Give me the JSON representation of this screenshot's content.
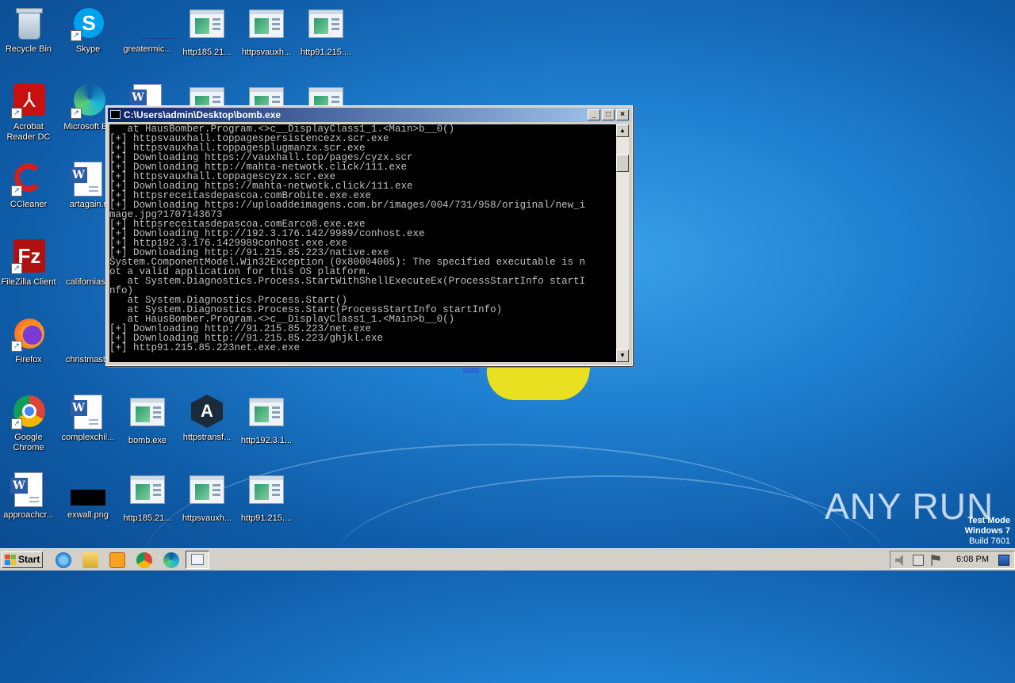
{
  "desktop": {
    "icons": [
      {
        "label": "Recycle Bin"
      },
      {
        "label": "Skype"
      },
      {
        "label": "greatermic..."
      },
      {
        "label": "http185.21..."
      },
      {
        "label": "httpsvauxh..."
      },
      {
        "label": "http91.215...."
      },
      {
        "label": "Acrobat Reader DC"
      },
      {
        "label": "Microsoft Ed"
      },
      {
        "label": "CCleaner"
      },
      {
        "label": "artagain.r"
      },
      {
        "label": "FileZilla Client"
      },
      {
        "label": "californiaso"
      },
      {
        "label": "Firefox"
      },
      {
        "label": "christmasth"
      },
      {
        "label": "Google Chrome"
      },
      {
        "label": "complexchil..."
      },
      {
        "label": "bomb.exe"
      },
      {
        "label": "httpstransf..."
      },
      {
        "label": "http192.3.1..."
      },
      {
        "label": "approachcr..."
      },
      {
        "label": "exwall.png"
      },
      {
        "label": "http185.21..."
      },
      {
        "label": "httpsvauxh..."
      },
      {
        "label": "http91.215...."
      }
    ]
  },
  "window": {
    "title": "C:\\Users\\admin\\Desktop\\bomb.exe",
    "minimize": "_",
    "maximize": "□",
    "close": "×",
    "console_lines": [
      "   at HausBomber.Program.<>c__DisplayClass1_1.<Main>b__0()",
      "[+] httpsvauxhall.toppagespersistencezx.scr.exe",
      "[+] httpsvauxhall.toppagesplugmanzx.scr.exe",
      "[+] Downloading https://vauxhall.top/pages/cyzx.scr",
      "[+] Downloading http://mahta-netwotk.click/111.exe",
      "[+] httpsvauxhall.toppagescyzx.scr.exe",
      "[+] Downloading https://mahta-netwotk.click/111.exe",
      "[+] httpsreceitasdepascoa.comBrobite.exe.exe",
      "[+] Downloading https://uploaddeimagens.com.br/images/004/731/958/original/new_i",
      "mage.jpg?1707143673",
      "[+] httpsreceitasdepascoa.comEarco8.exe.exe",
      "[+] Downloading http://192.3.176.142/9989/conhost.exe",
      "[+] http192.3.176.1429989conhost.exe.exe",
      "[+] Downloading http://91.215.85.223/native.exe",
      "System.ComponentModel.Win32Exception (0x80004005): The specified executable is n",
      "ot a valid application for this OS platform.",
      "   at System.Diagnostics.Process.StartWithShellExecuteEx(ProcessStartInfo startI",
      "nfo)",
      "   at System.Diagnostics.Process.Start()",
      "   at System.Diagnostics.Process.Start(ProcessStartInfo startInfo)",
      "   at HausBomber.Program.<>c__DisplayClass1_1.<Main>b__0()",
      "[+] Downloading http://91.215.85.223/net.exe",
      "[+] Downloading http://91.215.85.223/ghjkl.exe",
      "[+] http91.215.85.223net.exe.exe"
    ]
  },
  "taskbar": {
    "start_label": "Start",
    "clock": "6:08 PM"
  },
  "watermark": {
    "line1": "Test Mode",
    "line2": "Windows 7",
    "line3": "Build 7601",
    "brand": "ANY RUN"
  },
  "colors": {
    "console_bg": "#000000",
    "console_fg": "#c0c0c0",
    "title_active": "#0a246a",
    "desktop": "#1f7fd0"
  }
}
